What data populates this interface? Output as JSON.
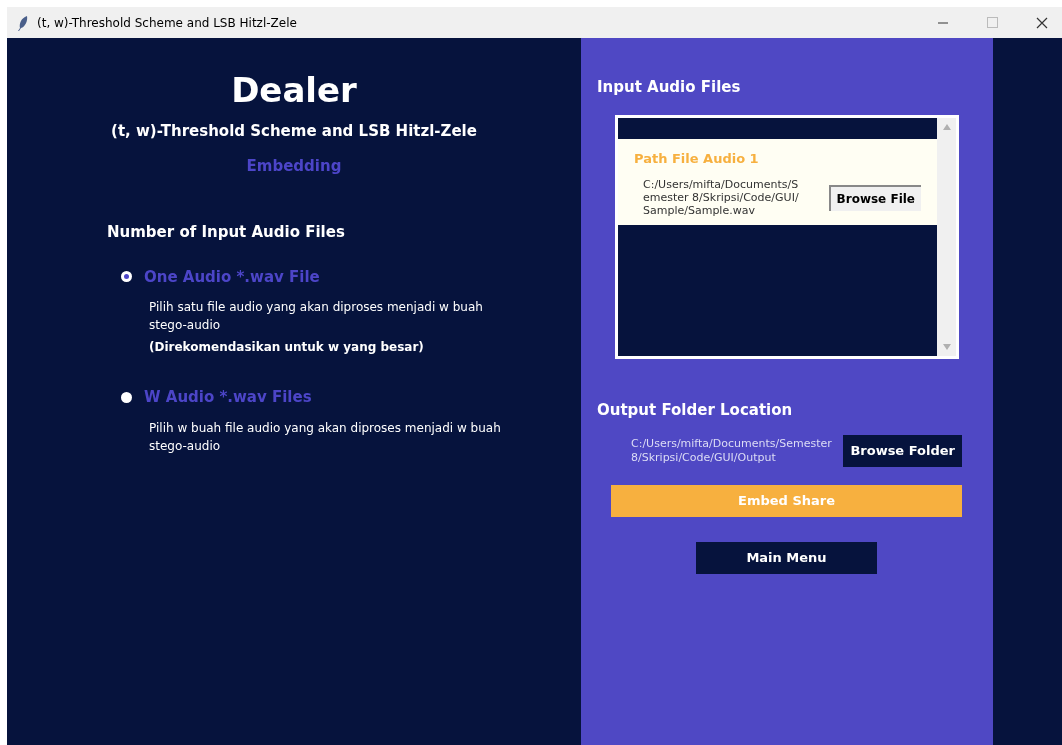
{
  "window": {
    "title": "(t, w)-Threshold Scheme and LSB Hitzl-Zele"
  },
  "left": {
    "heading": "Dealer",
    "subtitle": "(t, w)-Threshold Scheme and LSB Hitzl-Zele",
    "mode": "Embedding",
    "section_title": "Number of Input Audio Files",
    "options": [
      {
        "label": "One Audio *.wav File",
        "selected": true,
        "description": "Pilih satu file audio yang akan diproses menjadi w buah stego-audio",
        "note": "(Direkomendasikan untuk w yang besar)"
      },
      {
        "label": "W Audio *.wav Files",
        "selected": false,
        "description": "Pilih w buah file audio yang akan diproses menjadi w buah stego-audio"
      }
    ]
  },
  "right": {
    "input_title": "Input Audio Files",
    "files": [
      {
        "label": "Path File Audio 1",
        "path": "C:/Users/mifta/Documents/Semester 8/Skripsi/Code/GUI/Sample/Sample.wav",
        "button": "Browse File"
      }
    ],
    "output_title": "Output Folder Location",
    "output_path": "C:/Users/mifta/Documents/Semester 8/Skripsi/Code/GUI/Output",
    "browse_folder": "Browse Folder",
    "embed": "Embed Share",
    "main_menu": "Main Menu"
  }
}
